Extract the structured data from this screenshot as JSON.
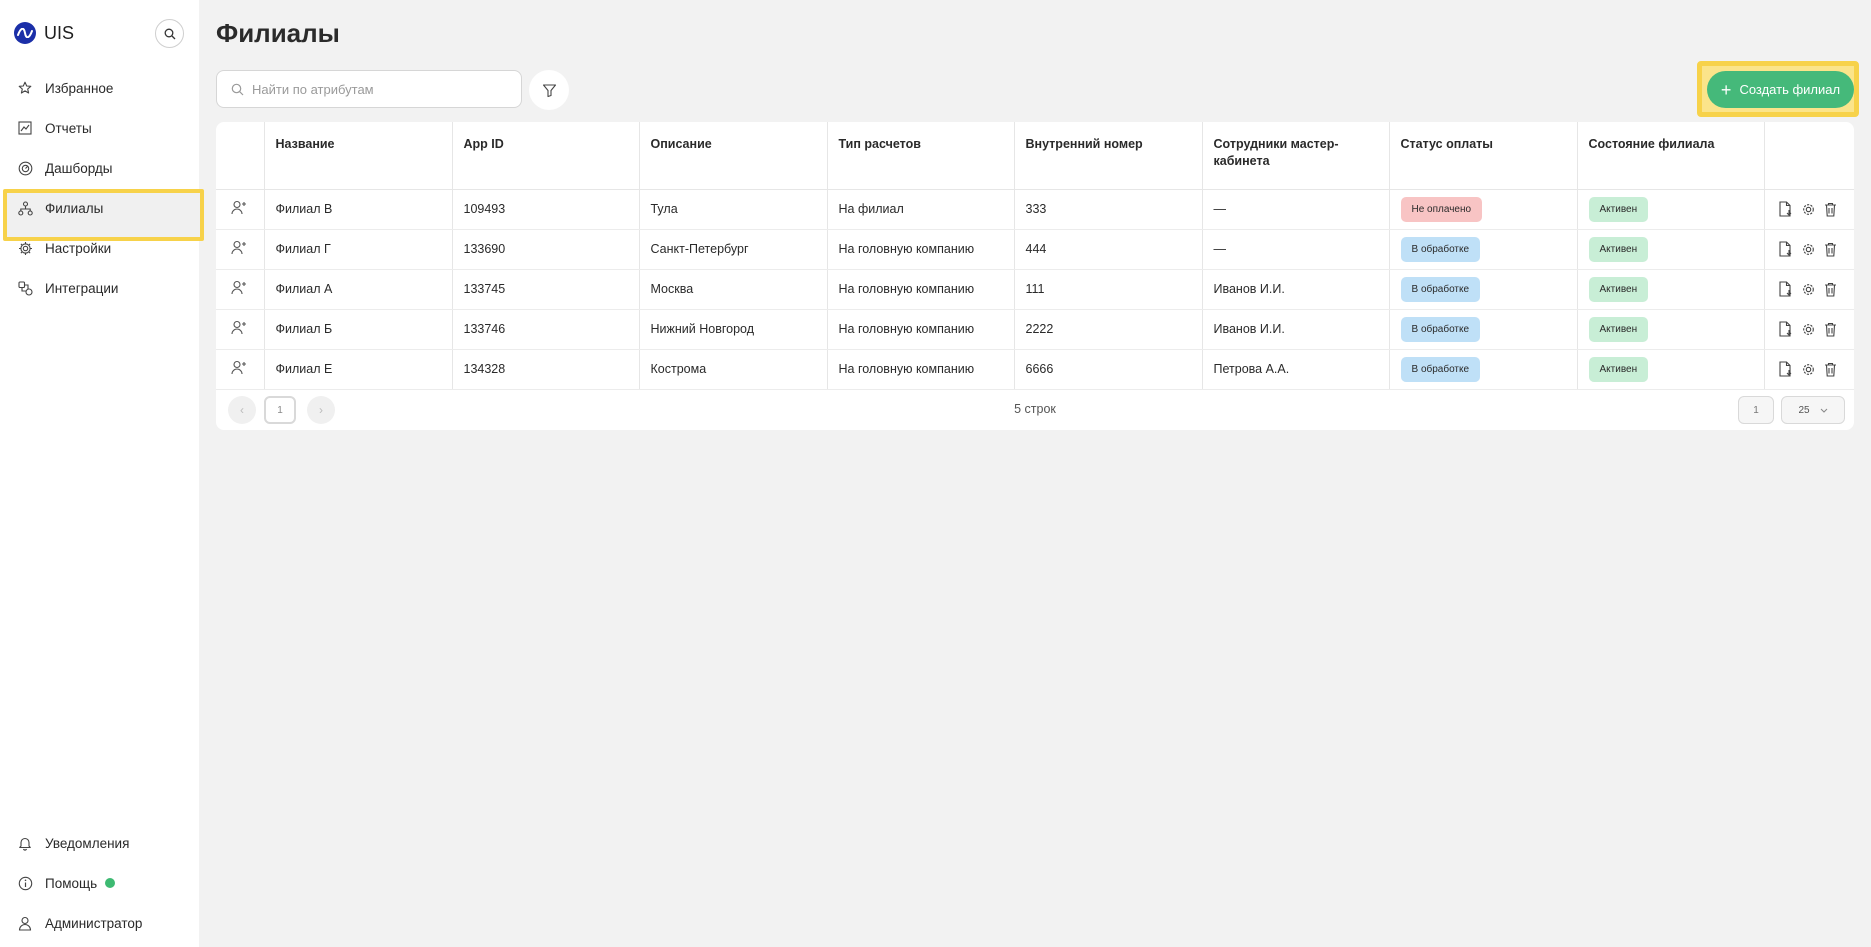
{
  "sidebar": {
    "brand": "UIS",
    "nav_top": [
      {
        "label": "Избранное",
        "icon": "star-icon"
      },
      {
        "label": "Отчеты",
        "icon": "chart-icon"
      },
      {
        "label": "Дашборды",
        "icon": "gauge-icon"
      },
      {
        "label": "Филиалы",
        "icon": "hierarchy-icon",
        "active": true
      },
      {
        "label": "Настройки",
        "icon": "gear-icon"
      },
      {
        "label": "Интеграции",
        "icon": "integration-icon"
      }
    ],
    "nav_bottom": [
      {
        "label": "Уведомления",
        "icon": "bell-icon"
      },
      {
        "label": "Помощь",
        "icon": "info-icon"
      },
      {
        "label": "Администратор",
        "icon": "user-icon"
      }
    ]
  },
  "main": {
    "title": "Филиалы",
    "search_placeholder": "Найти по атрибутам",
    "create_label": "Создать филиал",
    "table": {
      "headers": [
        "Название",
        "App ID",
        "Описание",
        "Тип расчетов",
        "Внутренний номер",
        "Сотрудники мастер-кабинета",
        "Статус оплаты",
        "Состояние филиала"
      ],
      "rows": [
        {
          "name": "Филиал В",
          "app_id": "109493",
          "description": "Тула",
          "billing": "На филиал",
          "internal": "333",
          "staff": "—",
          "payment": "Не оплачено",
          "state": "Активен"
        },
        {
          "name": "Филиал Г",
          "app_id": "133690",
          "description": "Санкт-Петербург",
          "billing": "На головную компанию",
          "internal": "444",
          "staff": "—",
          "payment": "В обработке",
          "state": "Активен"
        },
        {
          "name": "Филиал А",
          "app_id": "133745",
          "description": "Москва",
          "billing": "На головную компанию",
          "internal": "111",
          "staff": "Иванов И.И.",
          "payment": "В обработке",
          "state": "Активен"
        },
        {
          "name": "Филиал Б",
          "app_id": "133746",
          "description": "Нижний Новгород",
          "billing": "На головную компанию",
          "internal": "2222",
          "staff": "Иванов И.И.",
          "payment": "В обработке",
          "state": "Активен"
        },
        {
          "name": "Филиал Е",
          "app_id": "134328",
          "description": "Кострома",
          "billing": "На головную компанию",
          "internal": "6666",
          "staff": "Петрова А.А.",
          "payment": "В обработке",
          "state": "Активен"
        }
      ]
    },
    "pagination": {
      "current": "1",
      "rows_count": "5 строк",
      "page": "1",
      "page_size": "25"
    }
  },
  "colors": {
    "accent_green": "#45b97a",
    "highlight_yellow": "#f7d24a",
    "badge_unpaid": "#f8c4c4",
    "badge_processing": "#bfe0f7",
    "badge_active": "#c8eed6"
  }
}
